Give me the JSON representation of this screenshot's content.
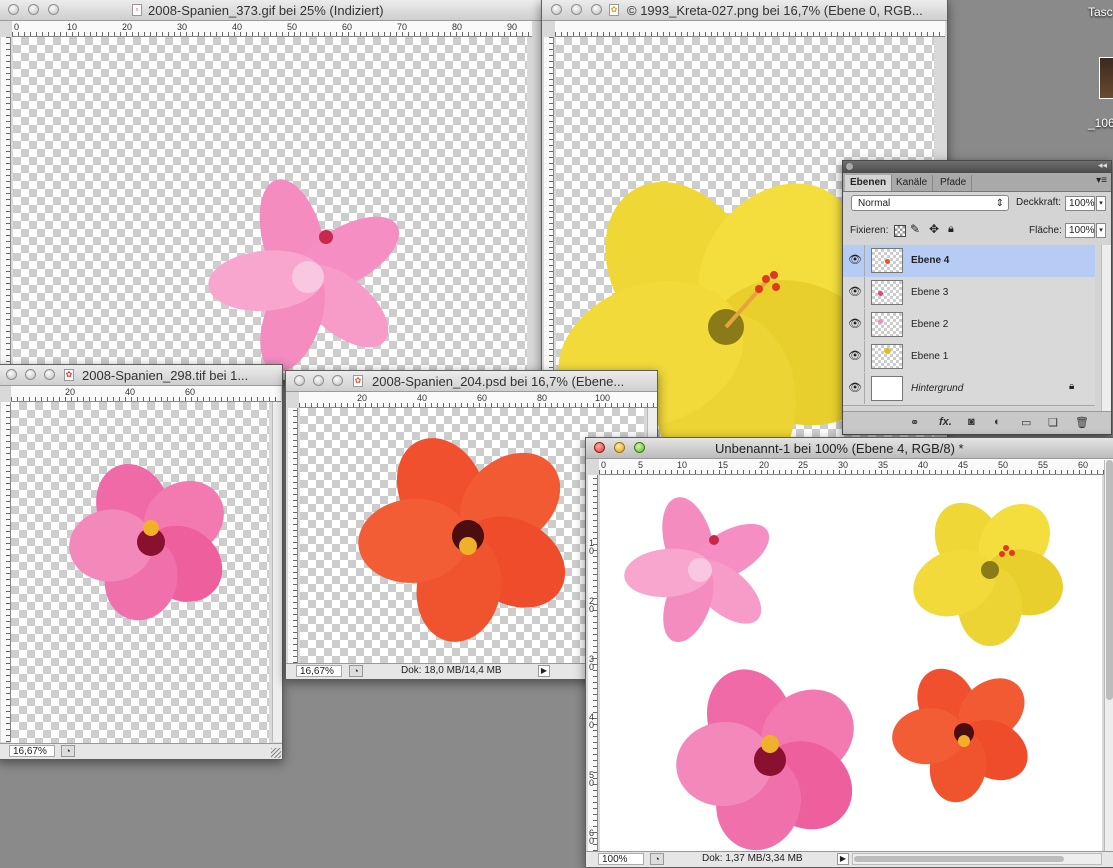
{
  "desktop": {
    "label_top": "Tasc",
    "label_file": "_106"
  },
  "windows": {
    "w373": {
      "title": "2008-Spanien_373.gif bei 25% (Indiziert)",
      "ruler": [
        "0",
        "10",
        "20",
        "30",
        "40",
        "50",
        "60",
        "70",
        "80",
        "90"
      ]
    },
    "kreta": {
      "title": "© 1993_Kreta-027.png bei 16,7% (Ebene 0, RGB..."
    },
    "w298": {
      "title": "2008-Spanien_298.tif bei 1...",
      "ruler": [
        "20",
        "40",
        "60"
      ],
      "zoom": "16,67%"
    },
    "w204": {
      "title": "2008-Spanien_204.psd bei 16,7% (Ebene...",
      "ruler": [
        "20",
        "40",
        "60",
        "80",
        "100"
      ],
      "zoom": "16,67%",
      "doc_size": "Dok: 18,0 MB/14,4 MB"
    },
    "main": {
      "title": "Unbenannt-1 bei 100% (Ebene 4, RGB/8) *",
      "ruler": [
        "0",
        "5",
        "10",
        "15",
        "20",
        "25",
        "30",
        "35",
        "40",
        "45",
        "50",
        "55",
        "60"
      ],
      "vruler": [
        "1\n0",
        "2\n0",
        "3\n0",
        "4\n0",
        "5\n0",
        "6\n0"
      ],
      "zoom": "100%",
      "doc_size": "Dok: 1,37 MB/3,34 MB"
    }
  },
  "layers_panel": {
    "tabs": [
      "Ebenen",
      "Kanäle",
      "Pfade"
    ],
    "blend_mode": "Normal",
    "opacity_label": "Deckkraft:",
    "opacity_value": "100%",
    "lock_label": "Fixieren:",
    "fill_label": "Fläche:",
    "fill_value": "100%",
    "layers": [
      {
        "name": "Ebene 4",
        "selected": true
      },
      {
        "name": "Ebene 3",
        "selected": false
      },
      {
        "name": "Ebene 2",
        "selected": false
      },
      {
        "name": "Ebene 1",
        "selected": false
      },
      {
        "name": "Hintergrund",
        "selected": false
      }
    ]
  },
  "colors": {
    "pink": "#f48cc0",
    "hibiscus_pink": "#f06aa8",
    "orange": "#f0502e",
    "yellow": "#f0dc3a",
    "selection": "#b6ccf5"
  }
}
